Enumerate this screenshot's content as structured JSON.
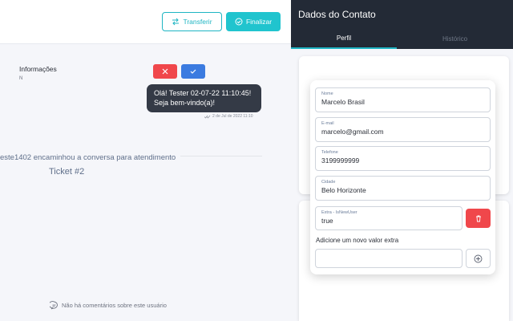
{
  "chat": {
    "transfer_label": "Transferir",
    "finalize_label": "Finalizar",
    "message": {
      "line1": "Olá! Tester 02-07-22 11:10:45!",
      "line2": "Seja bem-vindo(a)!",
      "timestamp": "2 de Jul de 2022 11:10"
    },
    "forward_text": "este1402 encaminhou a conversa para atendimento",
    "ticket": "Ticket #2"
  },
  "panel": {
    "title": "Dados do Contato",
    "tabs": [
      {
        "label": "Perfil",
        "active": true
      },
      {
        "label": "Histórico",
        "active": false
      }
    ],
    "info_title": "Informações",
    "info_sub": "N",
    "no_comments": "Não há comentários sobre este usuário"
  },
  "form": {
    "fields": {
      "nome": {
        "label": "Nome",
        "value": "Marcelo Brasil"
      },
      "email": {
        "label": "E-mail",
        "value": "marcelo@gmail.com"
      },
      "telefone": {
        "label": "Telefone",
        "value": "3199999999"
      },
      "cidade": {
        "label": "Cidade",
        "value": "Belo Horizonte"
      },
      "extra": {
        "label": "Extra - IsNewUser",
        "value": "true"
      }
    },
    "new_extra_label": "Adicione um novo valor extra",
    "new_extra_placeholder": ""
  },
  "colors": {
    "accent": "#20c4ce",
    "danger": "#f0474b",
    "primary": "#3b7be0",
    "dark": "#232a36"
  },
  "icons": {
    "transfer": "transfer-arrows-icon",
    "finalize": "check-circle-icon",
    "cancel": "close-icon",
    "confirm": "check-icon",
    "delete": "trash-icon",
    "add": "plus-circle-icon",
    "comment": "comment-icon",
    "read": "double-check-icon"
  }
}
